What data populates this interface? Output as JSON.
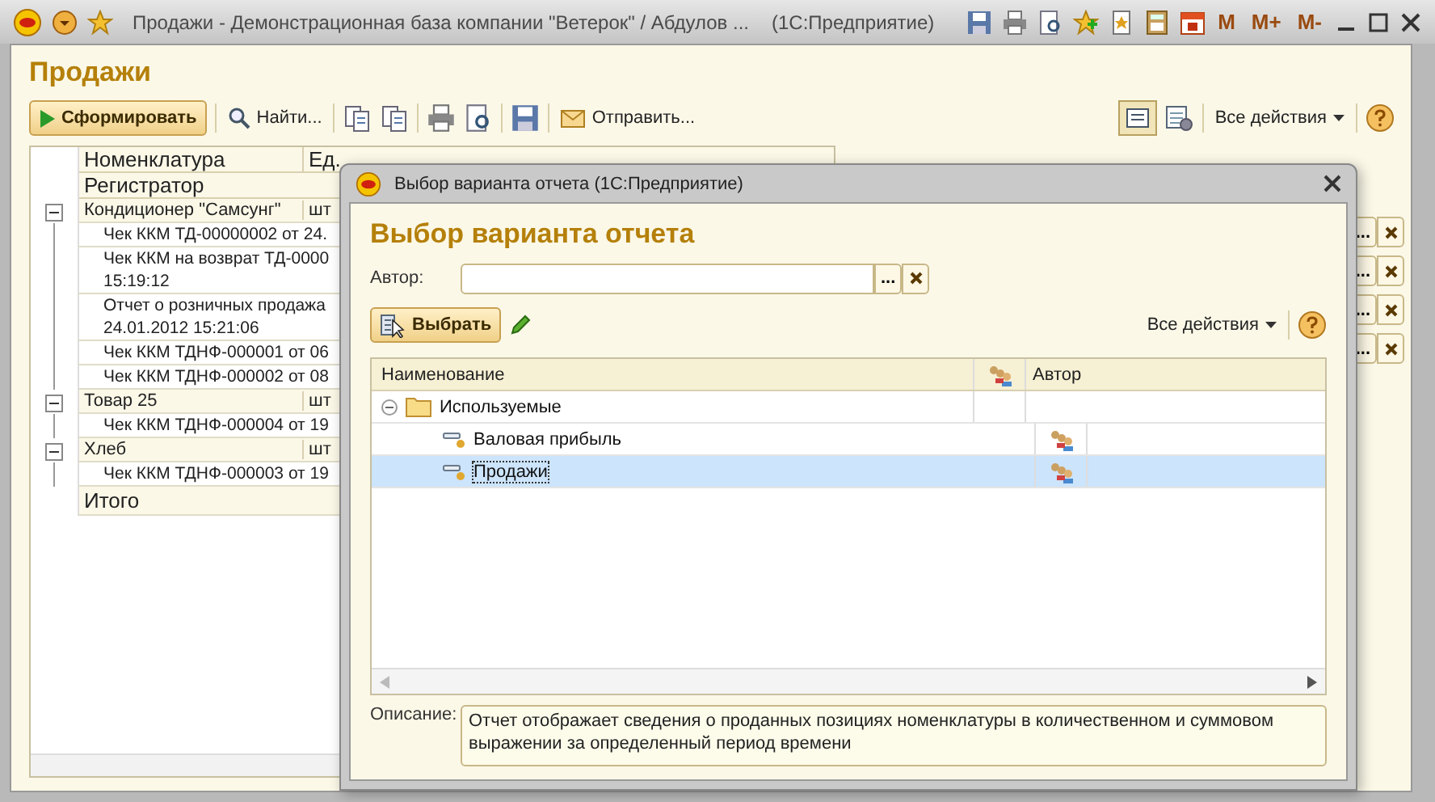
{
  "window": {
    "title": "Продажи - Демонстрационная база компании \"Ветерок\" / Абдулов ...",
    "app": "(1С:Предприятие)",
    "memory_buttons": [
      "M",
      "M+",
      "M-"
    ]
  },
  "form": {
    "title": "Продажи",
    "toolbar": {
      "generate": "Сформировать",
      "find": "Найти...",
      "send": "Отправить...",
      "all_actions": "Все действия",
      "list_view_on": true
    }
  },
  "report": {
    "columns": [
      "Номенклатура",
      "Ед."
    ],
    "subheader": "Регистратор",
    "total": "Итого",
    "rows": [
      {
        "kind": "group",
        "name": "Кондиционер \"Самсунг\"",
        "unit": "шт"
      },
      {
        "kind": "entry",
        "name": "Чек ККМ ТД-00000002 от 24."
      },
      {
        "kind": "entry",
        "name": "Чек ККМ на возврат ТД-0000\n15:19:12"
      },
      {
        "kind": "entry",
        "name": "Отчет о розничных продажа\n24.01.2012 15:21:06"
      },
      {
        "kind": "entry",
        "name": "Чек ККМ ТДНФ-000001 от 06"
      },
      {
        "kind": "entry",
        "name": "Чек ККМ ТДНФ-000002 от 08"
      },
      {
        "kind": "group",
        "name": "Товар 25",
        "unit": "шт"
      },
      {
        "kind": "entry",
        "name": "Чек ККМ ТДНФ-000004 от 19"
      },
      {
        "kind": "group",
        "name": "Хлеб",
        "unit": "шт"
      },
      {
        "kind": "entry",
        "name": "Чек ККМ ТДНФ-000003 от 19"
      }
    ]
  },
  "side_fields": [
    {
      "button": "..."
    },
    {
      "button": "..."
    },
    {
      "button": "..."
    },
    {
      "button": "..."
    }
  ],
  "dialog": {
    "title": "Выбор варианта отчета  (1С:Предприятие)",
    "heading": "Выбор варианта отчета",
    "author_label": "Автор:",
    "author_button": "...",
    "select": "Выбрать",
    "all_actions": "Все действия",
    "columns": [
      "Наименование",
      "Автор"
    ],
    "variants": [
      {
        "name": "Используемые",
        "expanded": true,
        "children": [
          {
            "name": "Валовая прибыль",
            "shared": true,
            "selected": false
          },
          {
            "name": "Продажи",
            "shared": true,
            "selected": true
          }
        ]
      }
    ],
    "description_label": "Описание:",
    "description": "Отчет отображает сведения о проданных позициях номенклатуры в количественном и суммовом выражении за определенный период времени"
  }
}
